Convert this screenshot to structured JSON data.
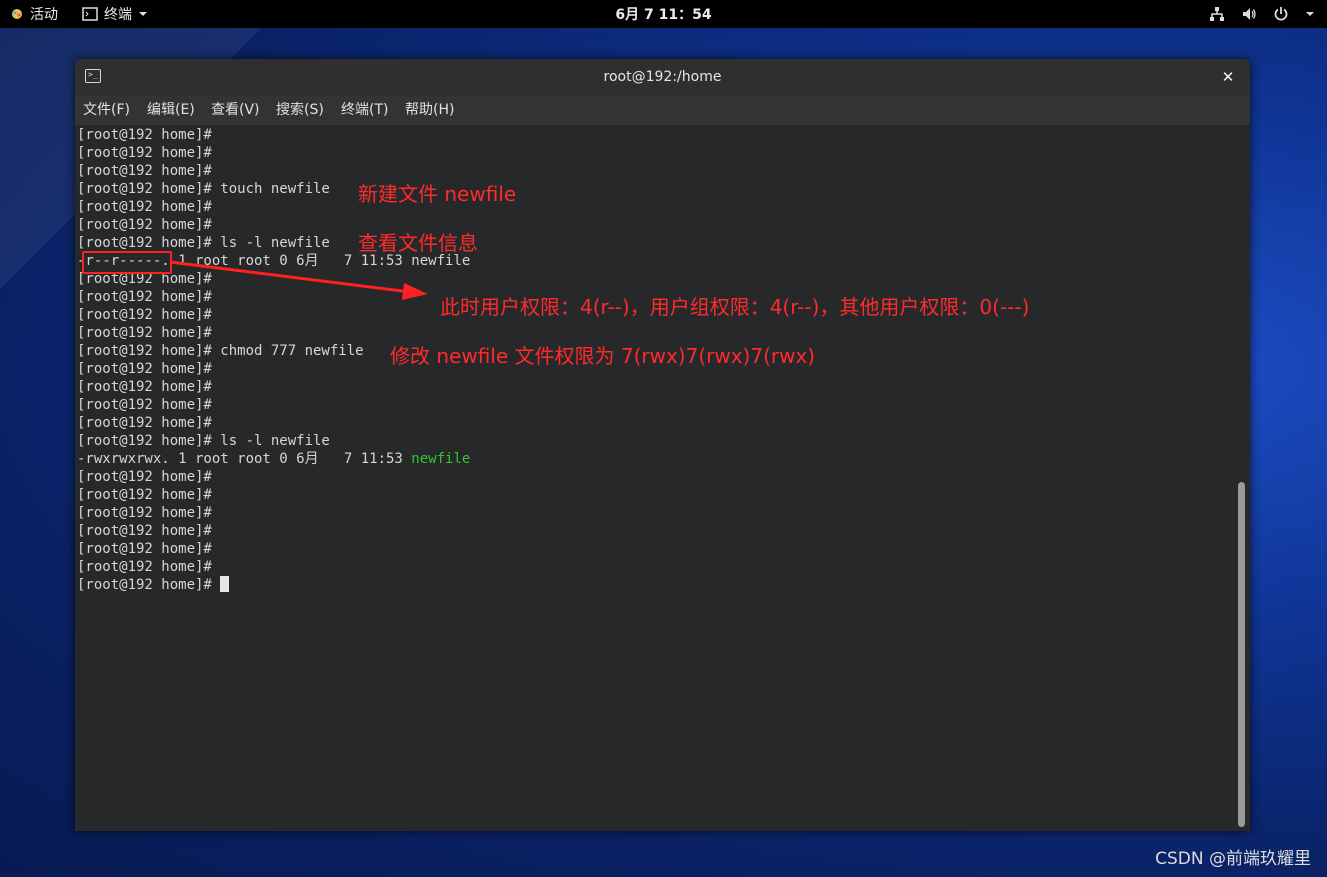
{
  "topbar": {
    "activities_label": "活动",
    "app_label": "终端",
    "clock": "6月 7  11：54",
    "icons": [
      "network-icon",
      "volume-icon",
      "power-icon",
      "chevron-down-icon"
    ]
  },
  "window": {
    "title": "root@192:/home",
    "close_glyph": "✕",
    "menu": [
      "文件(F)",
      "编辑(E)",
      "查看(V)",
      "搜索(S)",
      "终端(T)",
      "帮助(H)"
    ]
  },
  "terminal": {
    "lines": [
      {
        "prompt": "[root@192 home]#",
        "cmd": ""
      },
      {
        "prompt": "[root@192 home]#",
        "cmd": ""
      },
      {
        "prompt": "[root@192 home]#",
        "cmd": ""
      },
      {
        "prompt": "[root@192 home]#",
        "cmd": " touch newfile"
      },
      {
        "prompt": "[root@192 home]#",
        "cmd": ""
      },
      {
        "prompt": "[root@192 home]#",
        "cmd": ""
      },
      {
        "prompt": "[root@192 home]#",
        "cmd": " ls -l newfile"
      },
      {
        "prompt": "-r--r-----. 1 root root 0 6月   7 11:53 newfile",
        "cmd": ""
      },
      {
        "prompt": "[root@192 home]#",
        "cmd": ""
      },
      {
        "prompt": "[root@192 home]#",
        "cmd": ""
      },
      {
        "prompt": "[root@192 home]#",
        "cmd": ""
      },
      {
        "prompt": "[root@192 home]#",
        "cmd": ""
      },
      {
        "prompt": "[root@192 home]#",
        "cmd": " chmod 777 newfile"
      },
      {
        "prompt": "[root@192 home]#",
        "cmd": ""
      },
      {
        "prompt": "[root@192 home]#",
        "cmd": ""
      },
      {
        "prompt": "[root@192 home]#",
        "cmd": ""
      },
      {
        "prompt": "[root@192 home]#",
        "cmd": ""
      },
      {
        "prompt": "[root@192 home]#",
        "cmd": " ls -l newfile"
      },
      {
        "prompt": "-rwxrwxrwx. 1 root root 0 6月   7 11:53 ",
        "cmd": "",
        "green": "newfile"
      },
      {
        "prompt": "[root@192 home]#",
        "cmd": ""
      },
      {
        "prompt": "[root@192 home]#",
        "cmd": ""
      },
      {
        "prompt": "[root@192 home]#",
        "cmd": ""
      },
      {
        "prompt": "[root@192 home]#",
        "cmd": ""
      },
      {
        "prompt": "[root@192 home]#",
        "cmd": ""
      },
      {
        "prompt": "[root@192 home]#",
        "cmd": ""
      },
      {
        "prompt": "[root@192 home]#",
        "cmd": " ",
        "cursor": true
      }
    ]
  },
  "annotations": {
    "touch_note": "新建文件 newfile",
    "ls_note": "查看文件信息",
    "perm_note": "此时用户权限：4(r--)，用户组权限：4(r--)，其他用户权限：0(---)",
    "chmod_note": "修改 newfile 文件权限为 7(rwx)7(rwx)7(rwx)",
    "color": "#ff2b2b"
  },
  "watermark": "CSDN @前端玖耀里"
}
